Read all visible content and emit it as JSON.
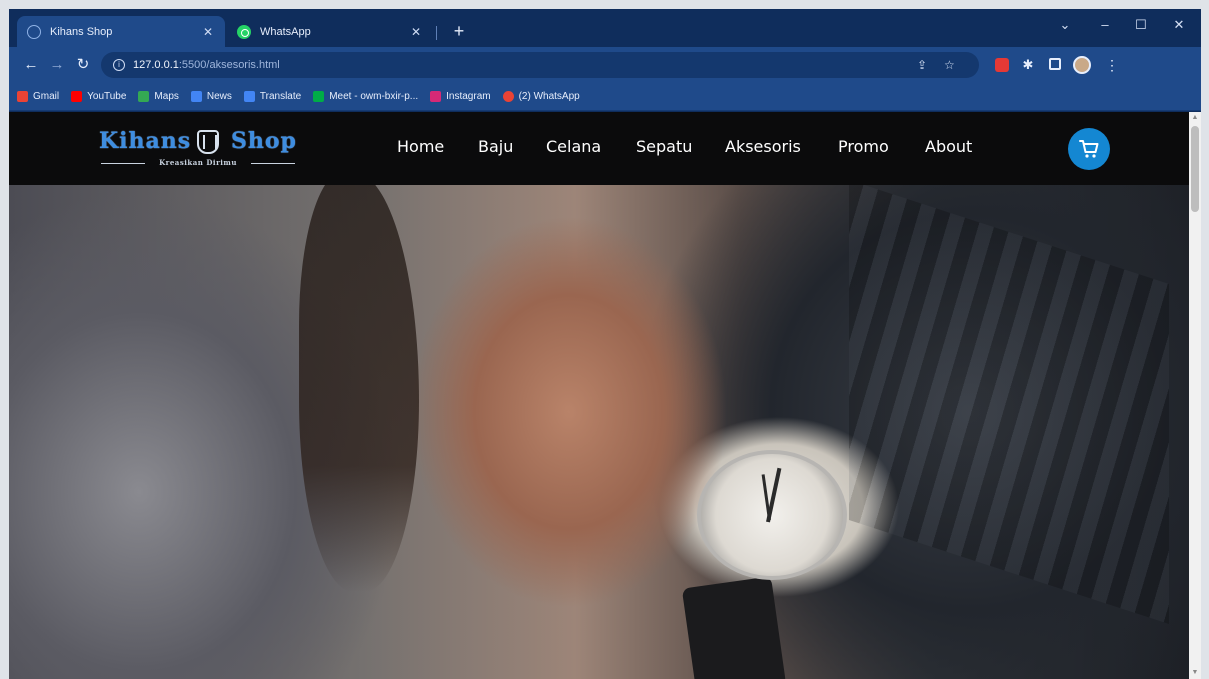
{
  "browser": {
    "tabs": [
      {
        "title": "Kihans Shop",
        "active": true
      },
      {
        "title": "WhatsApp",
        "active": false
      }
    ],
    "address": {
      "host": "127.0.0.1",
      "path": ":5500/aksesoris.html"
    },
    "bookmarks": [
      {
        "label": "Gmail",
        "color": "#ea4335"
      },
      {
        "label": "YouTube",
        "color": "#ff0000"
      },
      {
        "label": "Maps",
        "color": "#34a853"
      },
      {
        "label": "News",
        "color": "#4285f4"
      },
      {
        "label": "Translate",
        "color": "#4285f4"
      },
      {
        "label": "Meet - owm-bxir-p...",
        "color": "#00ac47"
      },
      {
        "label": "Instagram",
        "color": "#d62976"
      },
      {
        "label": "(2) WhatsApp",
        "color": "#ea4335"
      }
    ]
  },
  "site": {
    "logo": {
      "left_word": "Kihans",
      "right_word": "Shop",
      "tagline": "Kreasikan Dirimu"
    },
    "menu": [
      "Home",
      "Baju",
      "Celana",
      "Sepatu",
      "Aksesoris",
      "Promo",
      "About"
    ],
    "accent_color": "#1487d2"
  }
}
